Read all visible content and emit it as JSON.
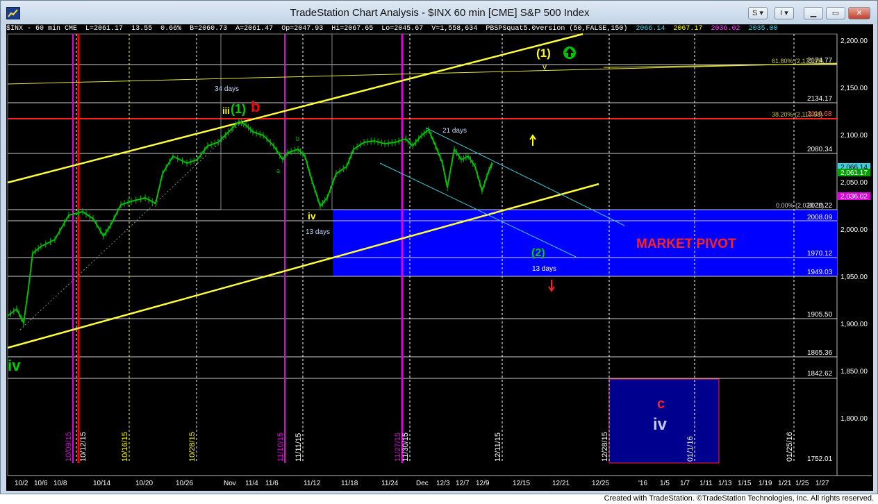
{
  "window": {
    "title": "TradeStation Chart Analysis - $INX 60 min [CME] S&P 500 Index",
    "btn_s": "S",
    "btn_i": "I",
    "minimize": "▭",
    "maximize": "▭",
    "close": "✕"
  },
  "status": {
    "symbol": "$INX - 60 min  CME",
    "last": "L=2061.17",
    "chg": "13.55",
    "pct": "0.66%",
    "bid": "B=2060.73",
    "ask": "A=2061.47",
    "open": "Op=2047.93",
    "hi": "Hi=2067.65",
    "lo": "Lo=2045.67",
    "vol": "V=1,558,634",
    "study": "PBSPSquat5.0version (50,FALSE,150)",
    "sv1": "2066.14",
    "sv2": "2067.17",
    "sv3": "2036.02",
    "sv4": "2035.00"
  },
  "colors": {
    "bg": "#000000",
    "price": "#00c000",
    "yellow": "#ffff00",
    "red": "#ff0000",
    "magenta": "#e000e0",
    "blue_zone": "#0000ff",
    "cyan": "#3ecfe0",
    "grid": "#c0c0c0"
  },
  "axis": {
    "price_labels": [
      "2,200.00",
      "2,150.00",
      "2,100.00",
      "2,050.00",
      "2,000.00",
      "1,950.00",
      "1,900.00",
      "1,850.00",
      "1,800.00"
    ],
    "date_labels": [
      "10/2",
      "10/6",
      "10/8",
      "10/14",
      "10/20",
      "10/26",
      "Nov",
      "11/4",
      "11/6",
      "11/12",
      "11/18",
      "11/24",
      "Dec",
      "12/3",
      "12/7",
      "12/9",
      "12/15",
      "12/21",
      "12/25",
      "'16",
      "1/5",
      "1/7",
      "1/11",
      "1/13",
      "1/15",
      "1/19",
      "1/21",
      "1/25",
      "1/27"
    ]
  },
  "levels": {
    "l2174": "2174.77",
    "l2134": "2134.17",
    "l2116": "2116.68",
    "l2080": "2080.34",
    "l2020": "2020.22",
    "l2008": "2008.09",
    "l1970": "1970.12",
    "l1949": "1949.03",
    "l1905": "1905.50",
    "l1865": "1865.36",
    "l1842": "1842.62",
    "l1752": "1752.01",
    "fib618": "61.80% (2,173.99)",
    "fib382": "38.20% (2,113.58)",
    "fib0": "0.00% (2,020.22)",
    "last_price": "2,061.17",
    "cur_price": "2,066.14",
    "pink_price": "2,036.02"
  },
  "dates_vertical": {
    "d1": "10/09/15",
    "d2": "10/12/15",
    "d3": "10/16/15",
    "d4": "10/28/15",
    "d5": "11/10/15",
    "d6": "11/11/15",
    "d7": "11/27/15",
    "d8": "11/30/15",
    "d9": "12/11/15",
    "d10": "12/28/15",
    "d11": "01/1/16",
    "d12": "01/25/16"
  },
  "annotations": {
    "wave1_top": "(1)",
    "wave1_small_v": "v",
    "iii": "iii",
    "wave1_green": "(1)",
    "b": "b",
    "a_small": "a",
    "b_small": "b",
    "iv_mid": "iv",
    "wave2": "(2)",
    "iv_left": "iv",
    "c": "c",
    "iv_box": "iv",
    "days34": "34 days",
    "days21": "21 days",
    "days13a": "13 days",
    "days13b": "13 days",
    "market_pivot": "MARKET PIVOT"
  },
  "footer": "Created with TradeStation. ©TradeStation Technologies, Inc. All rights reserved."
}
